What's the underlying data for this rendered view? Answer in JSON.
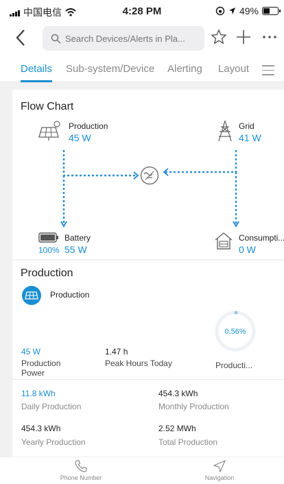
{
  "status_bar": {
    "carrier": "中国电信",
    "time": "4:28 PM",
    "battery_pct": "49%",
    "battery_level": 0.49
  },
  "header": {
    "search_placeholder": "Search Devices/Alerts in Pla..."
  },
  "tabs": [
    {
      "label": "Details",
      "active": true
    },
    {
      "label": "Sub-system/Device",
      "active": false
    },
    {
      "label": "Alerting",
      "active": false
    },
    {
      "label": "Layout",
      "active": false
    }
  ],
  "flow_chart": {
    "title": "Flow Chart",
    "production": {
      "label": "Production",
      "value": "45 W"
    },
    "grid": {
      "label": "Grid",
      "value": "41 W"
    },
    "battery": {
      "label": "Battery",
      "percent": "100%",
      "value": "55 W"
    },
    "consumption": {
      "label": "Consumpti...",
      "value": "0 W"
    }
  },
  "production": {
    "title": "Production",
    "badge_label": "Production",
    "gauge_value": "0.56%",
    "gauge_fraction": 0.0056,
    "power_value": "45 W",
    "power_label": "Production Power",
    "peak_value": "1.47 h",
    "peak_label": "Peak Hours Today",
    "gauge_label": "Producti...",
    "daily_value": "11.8 kWh",
    "daily_label": "Daily Production",
    "monthly_value": "454.3 kWh",
    "monthly_label": "Monthly Production",
    "yearly_value": "454.3 kWh",
    "yearly_label": "Yearly Production",
    "total_value": "2.52 MWh",
    "total_label": "Total Production"
  },
  "bottom_bar": {
    "phone_label": "Phone Number",
    "nav_label": "Navigation"
  },
  "colors": {
    "accent": "#1a8fd1",
    "flow_line": "#2a8fd4"
  }
}
